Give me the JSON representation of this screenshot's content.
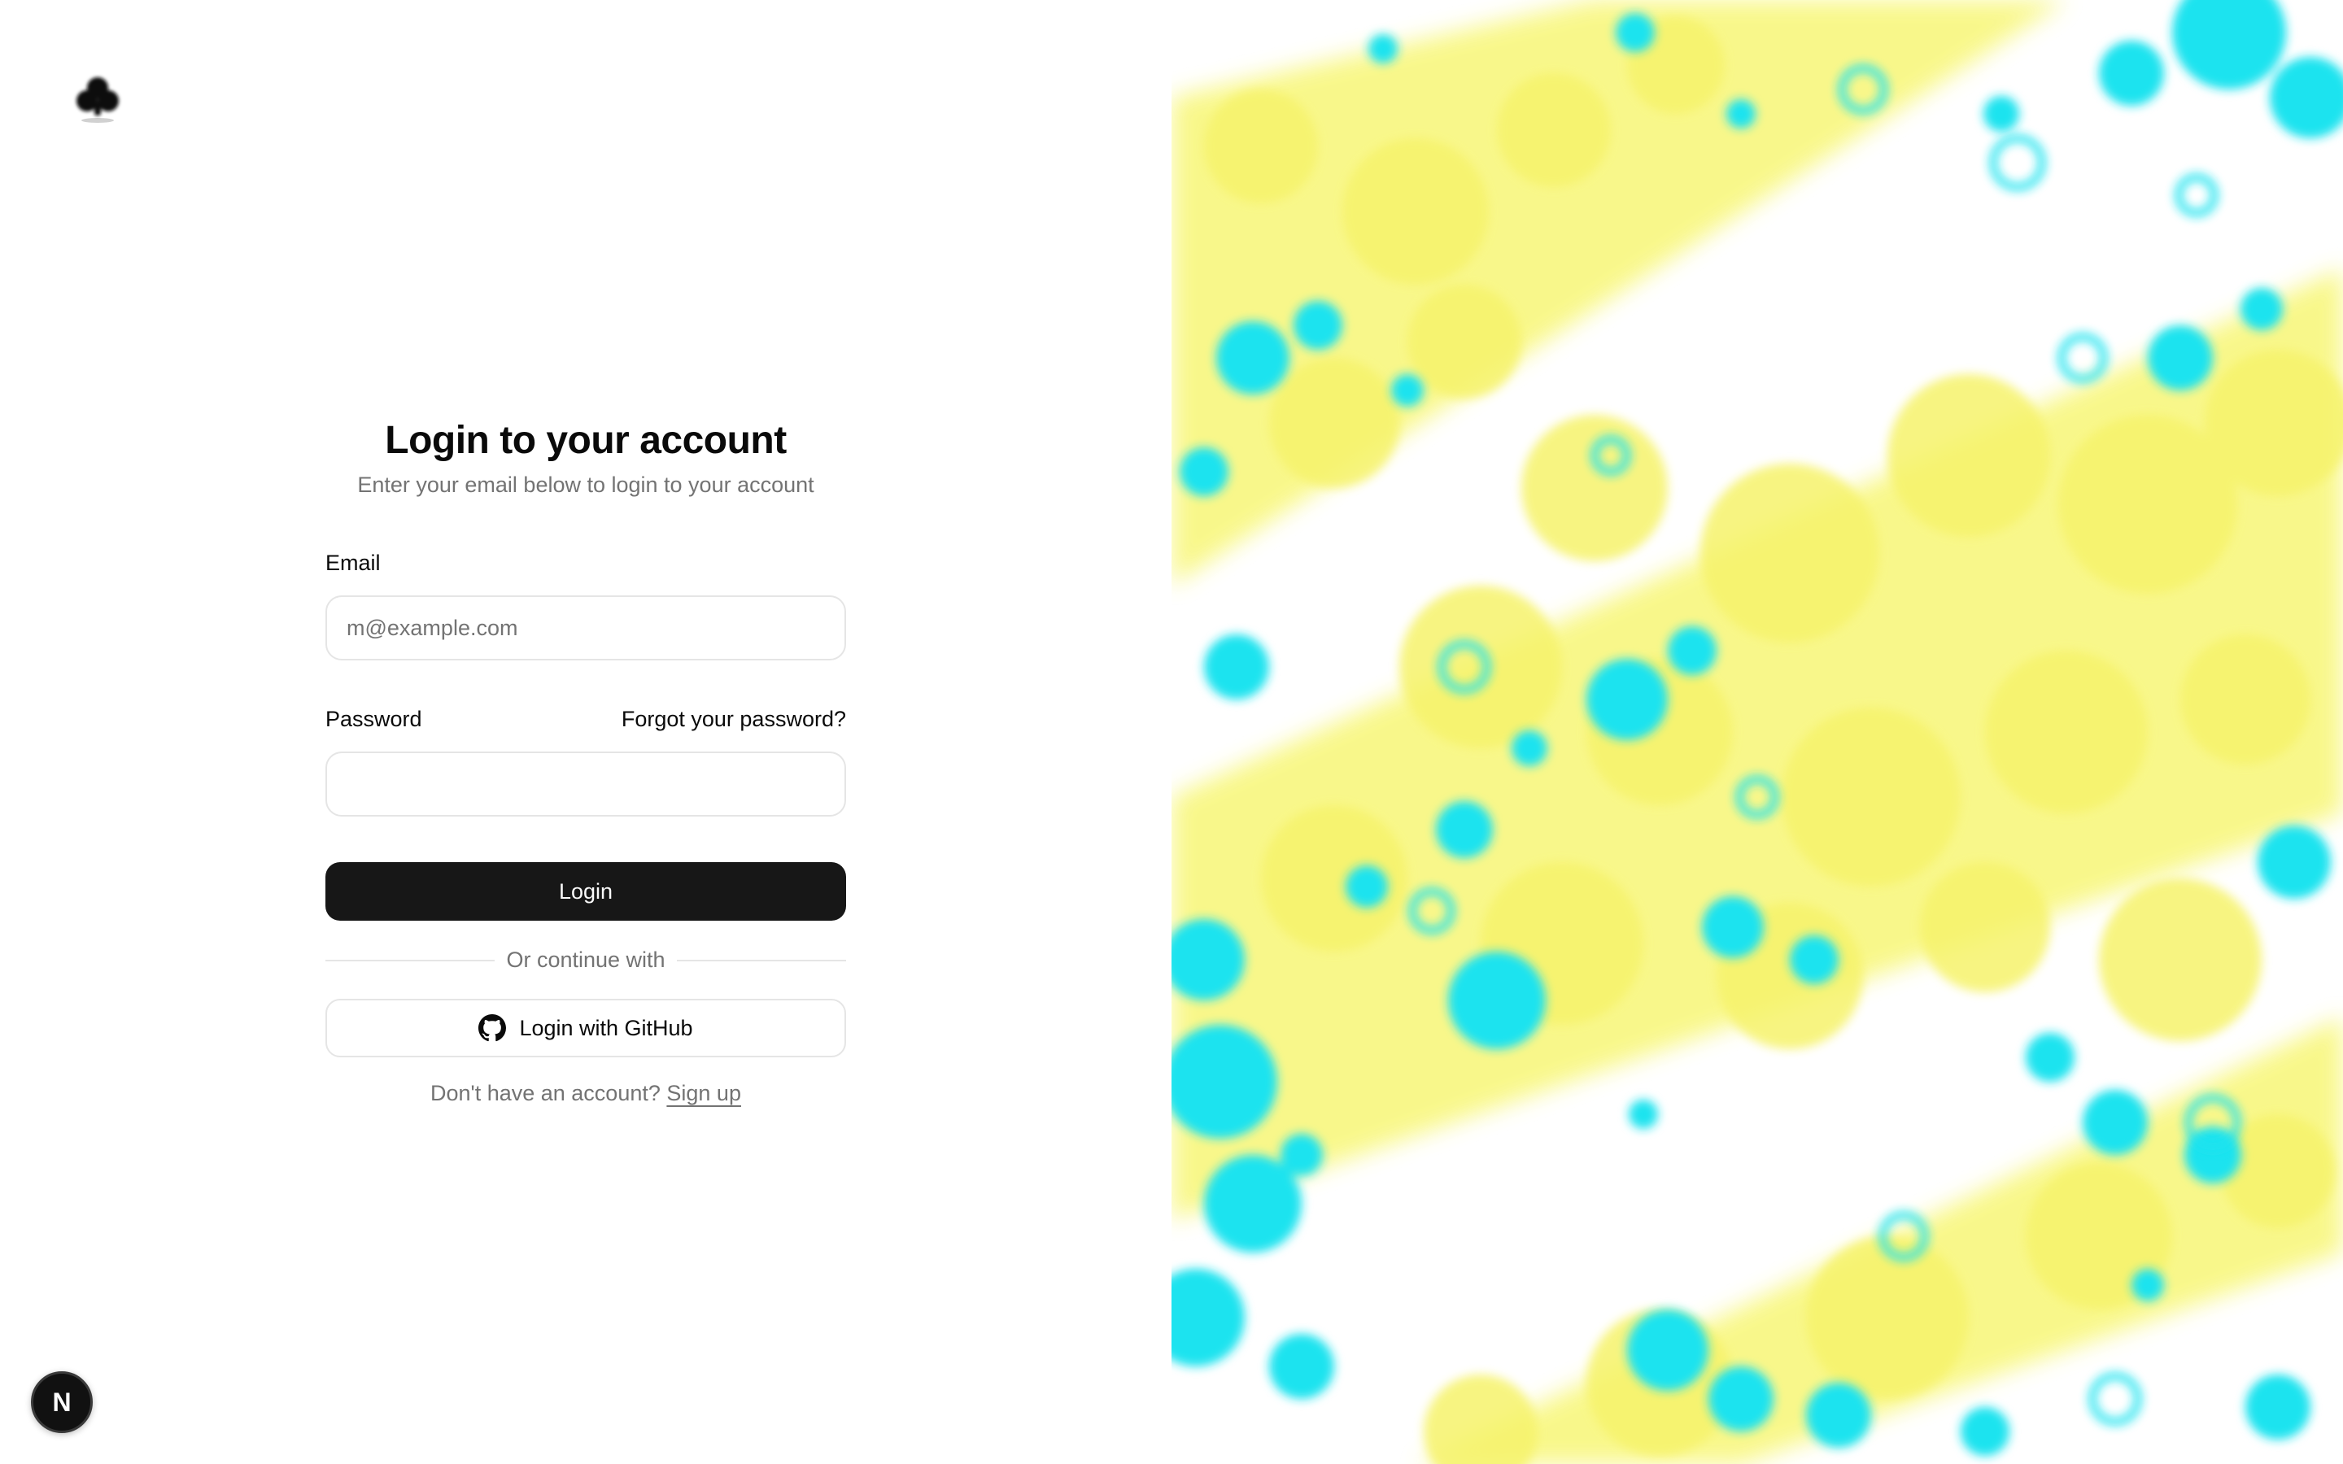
{
  "brand": {
    "logo_icon": "club-logo-icon"
  },
  "form": {
    "title": "Login to your account",
    "subtitle": "Enter your email below to login to your account",
    "email_label": "Email",
    "email_placeholder": "m@example.com",
    "email_value": "",
    "password_label": "Password",
    "forgot_link": "Forgot your password?",
    "password_value": "",
    "login_button": "Login",
    "divider_text": "Or continue with",
    "github_button": "Login with GitHub",
    "github_icon": "github-icon",
    "signup_prompt": "Don't have an account?",
    "signup_link": "Sign up"
  },
  "dev_badge": {
    "letter": "N",
    "icon": "nextjs-icon"
  },
  "colors": {
    "primary_button": "#171717",
    "text": "#0a0a0a",
    "muted_text": "#737373",
    "border": "#e5e5e5",
    "art_cyan": "#22e3ee",
    "art_yellow": "#f6f47a"
  }
}
